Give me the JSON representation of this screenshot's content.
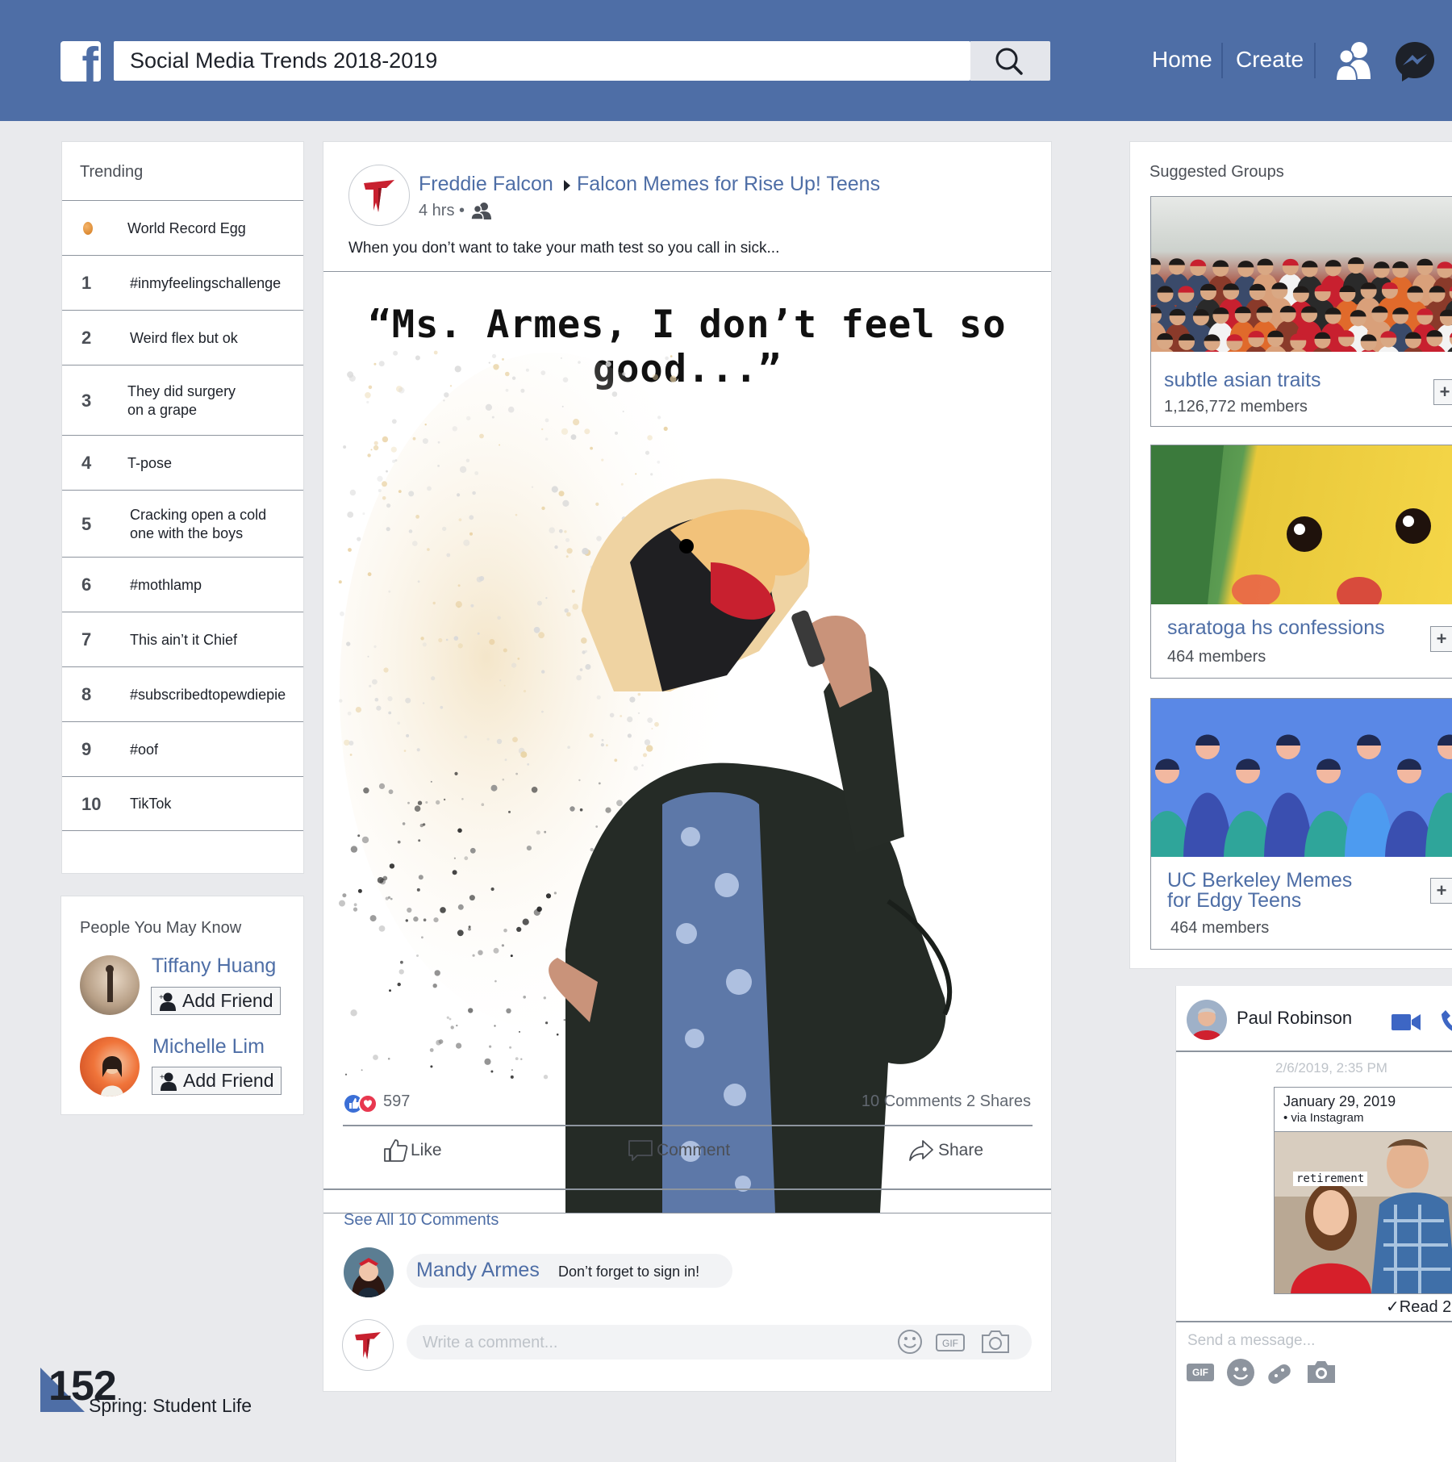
{
  "search": {
    "value": "Social Media Trends 2018-2019"
  },
  "nav": {
    "home": "Home",
    "create": "Create"
  },
  "trending": {
    "title": "Trending",
    "items": [
      {
        "rank": "",
        "label": "World Record Egg"
      },
      {
        "rank": "1",
        "label": "#inmyfeelingschallenge"
      },
      {
        "rank": "2",
        "label": "Weird flex but ok"
      },
      {
        "rank": "3",
        "label": "They did surgery\non a grape"
      },
      {
        "rank": "4",
        "label": "T-pose"
      },
      {
        "rank": "5",
        "label": "Cracking open a cold\none with the boys"
      },
      {
        "rank": "6",
        "label": "#mothlamp"
      },
      {
        "rank": "7",
        "label": "This ain’t it Chief"
      },
      {
        "rank": "8",
        "label": "#subscribedtopewdiepie"
      },
      {
        "rank": "9",
        "label": "#oof"
      },
      {
        "rank": "10",
        "label": "TikTok"
      }
    ]
  },
  "people": {
    "title": "People You May Know",
    "add_friend": "Add Friend",
    "list": [
      {
        "name": "Tiffany Huang"
      },
      {
        "name": "Michelle Lim"
      }
    ]
  },
  "post": {
    "author": "Freddie Falcon",
    "group": "Falcon Memes for Rise Up! Teens",
    "time": "4 hrs •",
    "caption": "When you don’t want to take your math test so you call in sick...",
    "meme_text": "“Ms. Armes, I don’t feel so good...”",
    "reactions": "597",
    "comments_shares": "10 Comments 2 Shares",
    "actions": {
      "like": "Like",
      "comment": "Comment",
      "share": "Share"
    },
    "see_all": "See All 10 Comments",
    "comment": {
      "author": "Mandy Armes",
      "text": "Don’t forget to sign in!"
    },
    "comment_placeholder": "Write a comment..."
  },
  "groups": {
    "title": "Suggested Groups",
    "join": "+",
    "list": [
      {
        "name": "subtle asian traits",
        "members": "1,126,772 members"
      },
      {
        "name": "saratoga hs confessions",
        "members": "464 members"
      },
      {
        "name": "UC Berkeley Memes\nfor Edgy Teens",
        "members": "464 members"
      }
    ]
  },
  "chat": {
    "name": "Paul Robinson",
    "timestamp": "2/6/2019, 2:35 PM",
    "shared_date": "January 29, 2019",
    "shared_via": "• via Instagram",
    "shared_caption": "retirement",
    "read": "✓Read 2",
    "placeholder": "Send a message...",
    "gif": "GIF"
  },
  "page": {
    "number": "152",
    "section": "Spring: Student Life"
  },
  "colors": {
    "brand": "#4e6ea6",
    "background": "#e9eaed",
    "link": "#4e6ea6"
  }
}
